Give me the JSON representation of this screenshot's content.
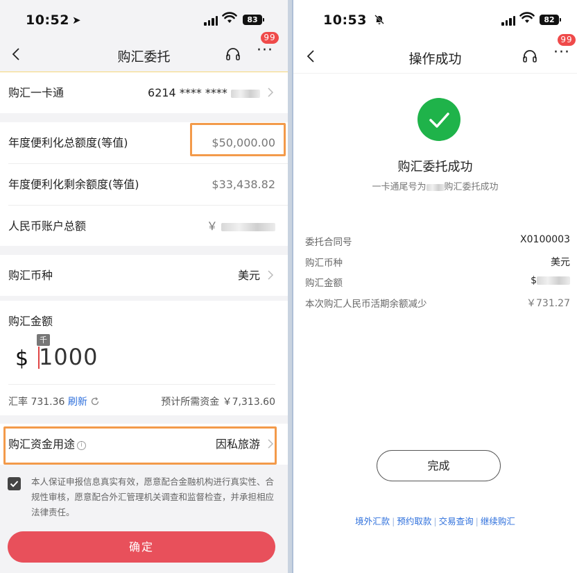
{
  "left": {
    "status": {
      "time": "10:52",
      "battery": "83"
    },
    "nav": {
      "title": "购汇委托",
      "badge": "99"
    },
    "card": {
      "label": "购汇一卡通",
      "value": "6214 **** ****"
    },
    "limits": {
      "total_label": "年度便利化总额度(等值)",
      "total_value": "$50,000.00",
      "remaining_label": "年度便利化剩余额度(等值)",
      "remaining_value": "$33,438.82",
      "rmb_label": "人民币账户总额",
      "rmb_value": "￥"
    },
    "currency": {
      "label": "购汇币种",
      "value": "美元"
    },
    "amount": {
      "label": "购汇金额",
      "unit_hint": "千",
      "symbol": "$",
      "value": "1000",
      "rate_label": "汇率 731.36",
      "refresh_label": "刷新",
      "need_label": "预计所需资金 ￥7,313.60"
    },
    "purpose": {
      "label": "购汇资金用途",
      "value": "因私旅游"
    },
    "agreement": "本人保证申报信息真实有效，愿意配合金融机构进行真实性、合规性审核，愿意配合外汇管理机关调查和监督检查，并承担相应法律责任。",
    "confirm_label": "确定"
  },
  "right": {
    "status": {
      "time": "10:53",
      "battery": "82"
    },
    "nav": {
      "title": "操作成功",
      "badge": "99"
    },
    "success": {
      "title": "购汇委托成功",
      "sub_prefix": "一卡通尾号为",
      "sub_suffix": "购汇委托成功"
    },
    "details": [
      {
        "label": "委托合同号",
        "value": "X0100003"
      },
      {
        "label": "购汇币种",
        "value": "美元"
      },
      {
        "label": "购汇金额",
        "value": "$"
      },
      {
        "label": "本次购汇人民币活期余额减少",
        "value": "￥731.27"
      }
    ],
    "done_label": "完成",
    "links": [
      "境外汇款",
      "预约取款",
      "交易查询",
      "继续购汇"
    ]
  },
  "colors": {
    "accent_red": "#e8505b",
    "highlight_orange": "#f39a4a",
    "link_blue": "#2d6fdc",
    "success_green": "#1fb34a",
    "badge_red": "#ef4a4a"
  }
}
